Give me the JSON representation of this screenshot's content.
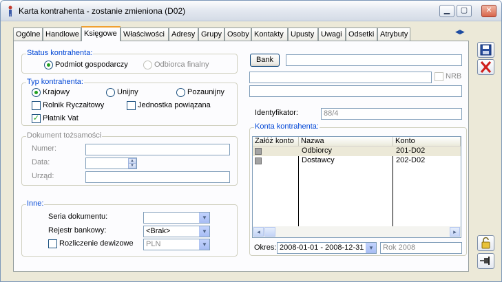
{
  "window": {
    "title": "Karta kontrahenta - zostanie zmieniona (D02)"
  },
  "tabs": [
    {
      "label": "Ogólne"
    },
    {
      "label": "Handlowe"
    },
    {
      "label": "Księgowe"
    },
    {
      "label": "Właściwości"
    },
    {
      "label": "Adresy"
    },
    {
      "label": "Grupy"
    },
    {
      "label": "Osoby"
    },
    {
      "label": "Kontakty"
    },
    {
      "label": "Upusty"
    },
    {
      "label": "Uwagi"
    },
    {
      "label": "Odsetki"
    },
    {
      "label": "Atrybuty"
    }
  ],
  "status": {
    "legend": "Status kontrahenta:",
    "option1": "Podmiot gospodarczy",
    "option2": "Odbiorca finalny"
  },
  "typ": {
    "legend": "Typ kontrahenta:",
    "krajowy": "Krajowy",
    "unijny": "Unijny",
    "pozaunijny": "Pozaunijny",
    "rolnik": "Rolnik Ryczałtowy",
    "jednostka": "Jednostka powiązana",
    "platnik": "Płatnik Vat"
  },
  "dokument": {
    "legend": "Dokument tożsamości",
    "numer_label": "Numer:",
    "data_label": "Data:",
    "urzad_label": "Urząd:"
  },
  "inne": {
    "legend": "Inne:",
    "seria_label": "Seria dokumentu:",
    "rejestr_label": "Rejestr bankowy:",
    "rejestr_value": "<Brak>",
    "rozliczenie_label": "Rozliczenie dewizowe",
    "waluta_value": "PLN"
  },
  "bank": {
    "button": "Bank",
    "nrb_label": "NRB"
  },
  "identyfikator": {
    "label": "Identyfikator:",
    "value": "88/4"
  },
  "konta": {
    "legend": "Konta kontrahenta:",
    "columns": [
      "Załóż konto",
      "Nazwa",
      "Konto"
    ],
    "rows": [
      {
        "nazwa": "Odbiorcy",
        "konto": "201-D02"
      },
      {
        "nazwa": "Dostawcy",
        "konto": "202-D02"
      }
    ],
    "okres_label": "Okres:",
    "okres_value": "2008-01-01 - 2008-12-31",
    "rok_value": "Rok 2008"
  },
  "colors": {
    "legend_blue": "#0046d5",
    "radio_green": "#21a121",
    "active_tab_accent": "#f0a030"
  }
}
